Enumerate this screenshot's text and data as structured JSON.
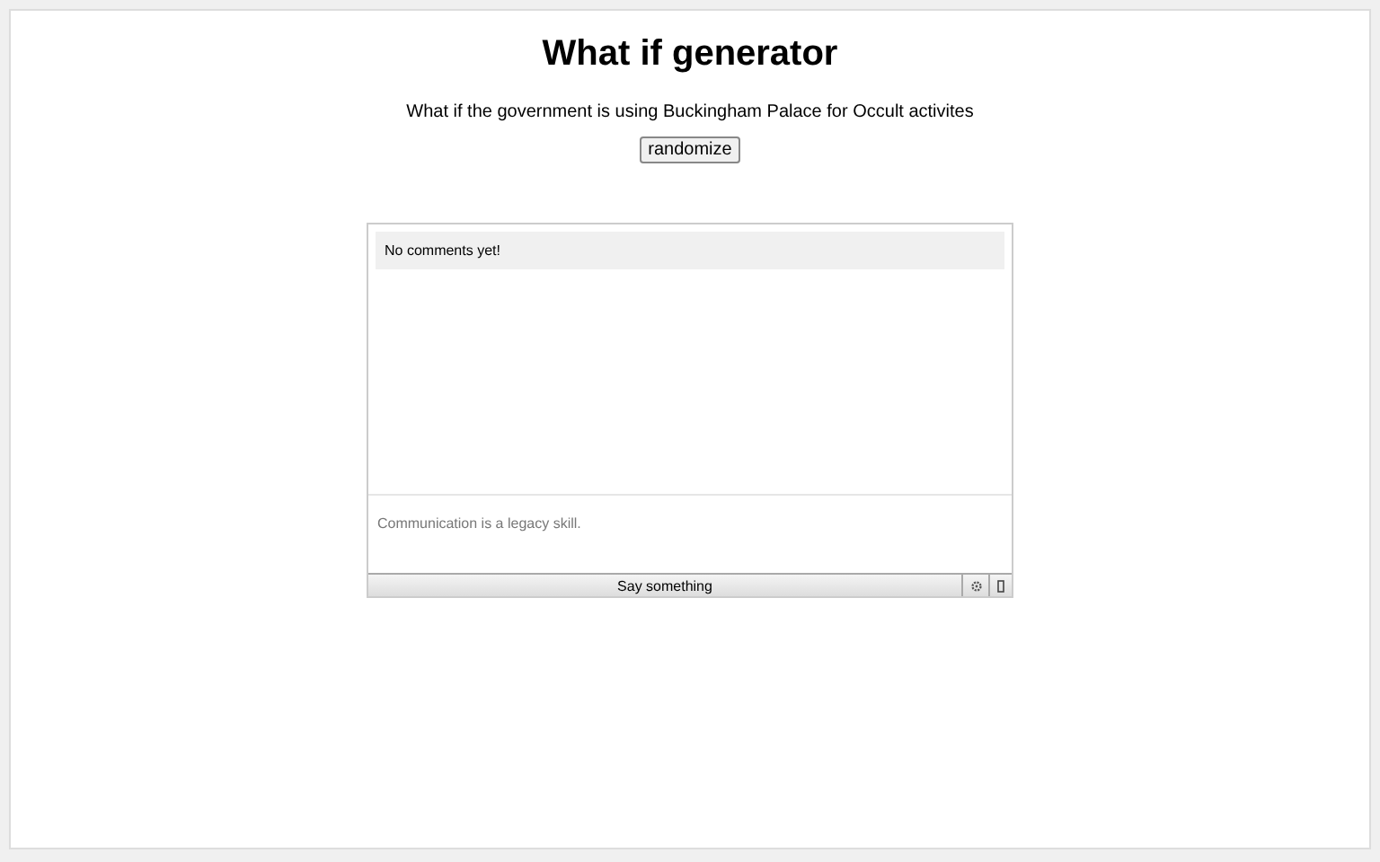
{
  "title": "What if generator",
  "sentence": "What if the government is using Buckingham Palace for Occult activites",
  "randomize_button": "randomize",
  "chat": {
    "messages": [
      "No comments yet!"
    ],
    "input": {
      "placeholder": "Communication is a legacy skill."
    },
    "send_button": "Say something"
  }
}
